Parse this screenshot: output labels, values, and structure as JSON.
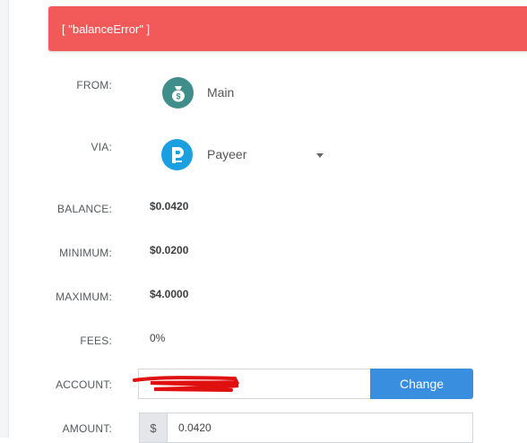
{
  "alert": {
    "text": "[ \"balanceError\" ]",
    "color": "#f25a5a"
  },
  "form": {
    "from": {
      "label": "FROM:",
      "value": "Main",
      "icon": "money-bag-icon"
    },
    "via": {
      "label": "VIA:",
      "value": "Payeer",
      "icon": "payeer-logo-icon"
    },
    "balance": {
      "label": "BALANCE:",
      "value": "$0.0420"
    },
    "minimum": {
      "label": "MINIMUM:",
      "value": "$0.0200"
    },
    "maximum": {
      "label": "MAXIMUM:",
      "value": "$4.0000"
    },
    "fees": {
      "label": "FEES:",
      "value": "0%"
    },
    "account": {
      "label": "ACCOUNT:",
      "button_label": "Change"
    },
    "amount": {
      "label": "AMOUNT:",
      "currency_symbol": "$",
      "value": "0.0420"
    }
  },
  "colors": {
    "button": "#3a8ee0",
    "from_icon": "#3f8e8b",
    "via_icon": "#1aa0e0"
  }
}
